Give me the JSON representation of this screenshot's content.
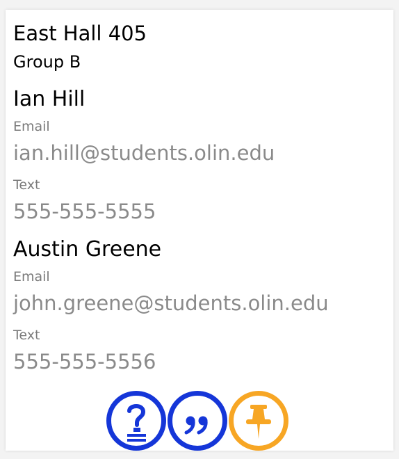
{
  "room": {
    "title": "East Hall 405",
    "group": "Group B"
  },
  "contacts": [
    {
      "name": "Ian Hill",
      "email_label": "Email",
      "email": "ian.hill@students.olin.edu",
      "text_label": "Text",
      "phone": "555-555-5555"
    },
    {
      "name": "Austin Greene",
      "email_label": "Email",
      "email": "john.greene@students.olin.edu",
      "text_label": "Text",
      "phone": "555-555-5556"
    }
  ],
  "actions": [
    {
      "icon": "question-icon",
      "color": "#1536d8"
    },
    {
      "icon": "quote-icon",
      "color": "#1536d8"
    },
    {
      "icon": "pushpin-icon",
      "color": "#f7a624"
    }
  ],
  "colors": {
    "primary_blue": "#1536d8",
    "accent_orange": "#f7a624",
    "muted_text": "#8a8a8a"
  }
}
